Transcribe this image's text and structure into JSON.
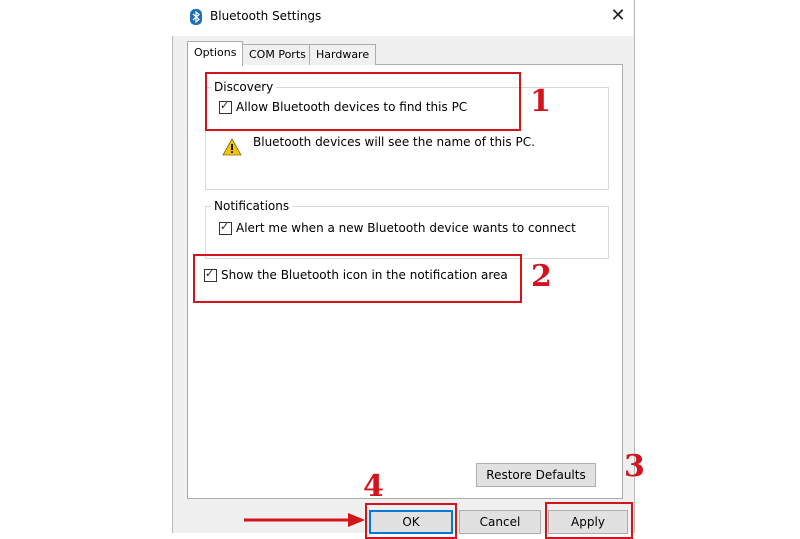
{
  "window": {
    "title": "Bluetooth Settings",
    "close_glyph": "✕"
  },
  "tabs": [
    {
      "label": "Options"
    },
    {
      "label": "COM Ports"
    },
    {
      "label": "Hardware"
    }
  ],
  "discovery": {
    "legend": "Discovery",
    "allow_label": "Allow Bluetooth devices to find this PC",
    "allow_checked": true,
    "info_text": "Bluetooth devices will see the name of this PC."
  },
  "notifications": {
    "legend": "Notifications",
    "alert_label": "Alert me when a new Bluetooth device wants to connect",
    "alert_checked": true
  },
  "show_icon": {
    "label": "Show the Bluetooth icon in the notification area",
    "checked": true
  },
  "buttons": {
    "restore_defaults": "Restore Defaults",
    "ok": "OK",
    "cancel": "Cancel",
    "apply": "Apply"
  },
  "annotations": {
    "n1": "1",
    "n2": "2",
    "n3": "3",
    "n4": "4"
  },
  "colors": {
    "annotation_red": "#d3141c",
    "focus_blue": "#0078d7",
    "bluetooth_blue": "#1f6fb5",
    "warning_yellow": "#f2c40f"
  },
  "icons": {
    "title": "bluetooth-icon",
    "warning": "warning-icon",
    "arrow": "arrow-right-icon"
  }
}
